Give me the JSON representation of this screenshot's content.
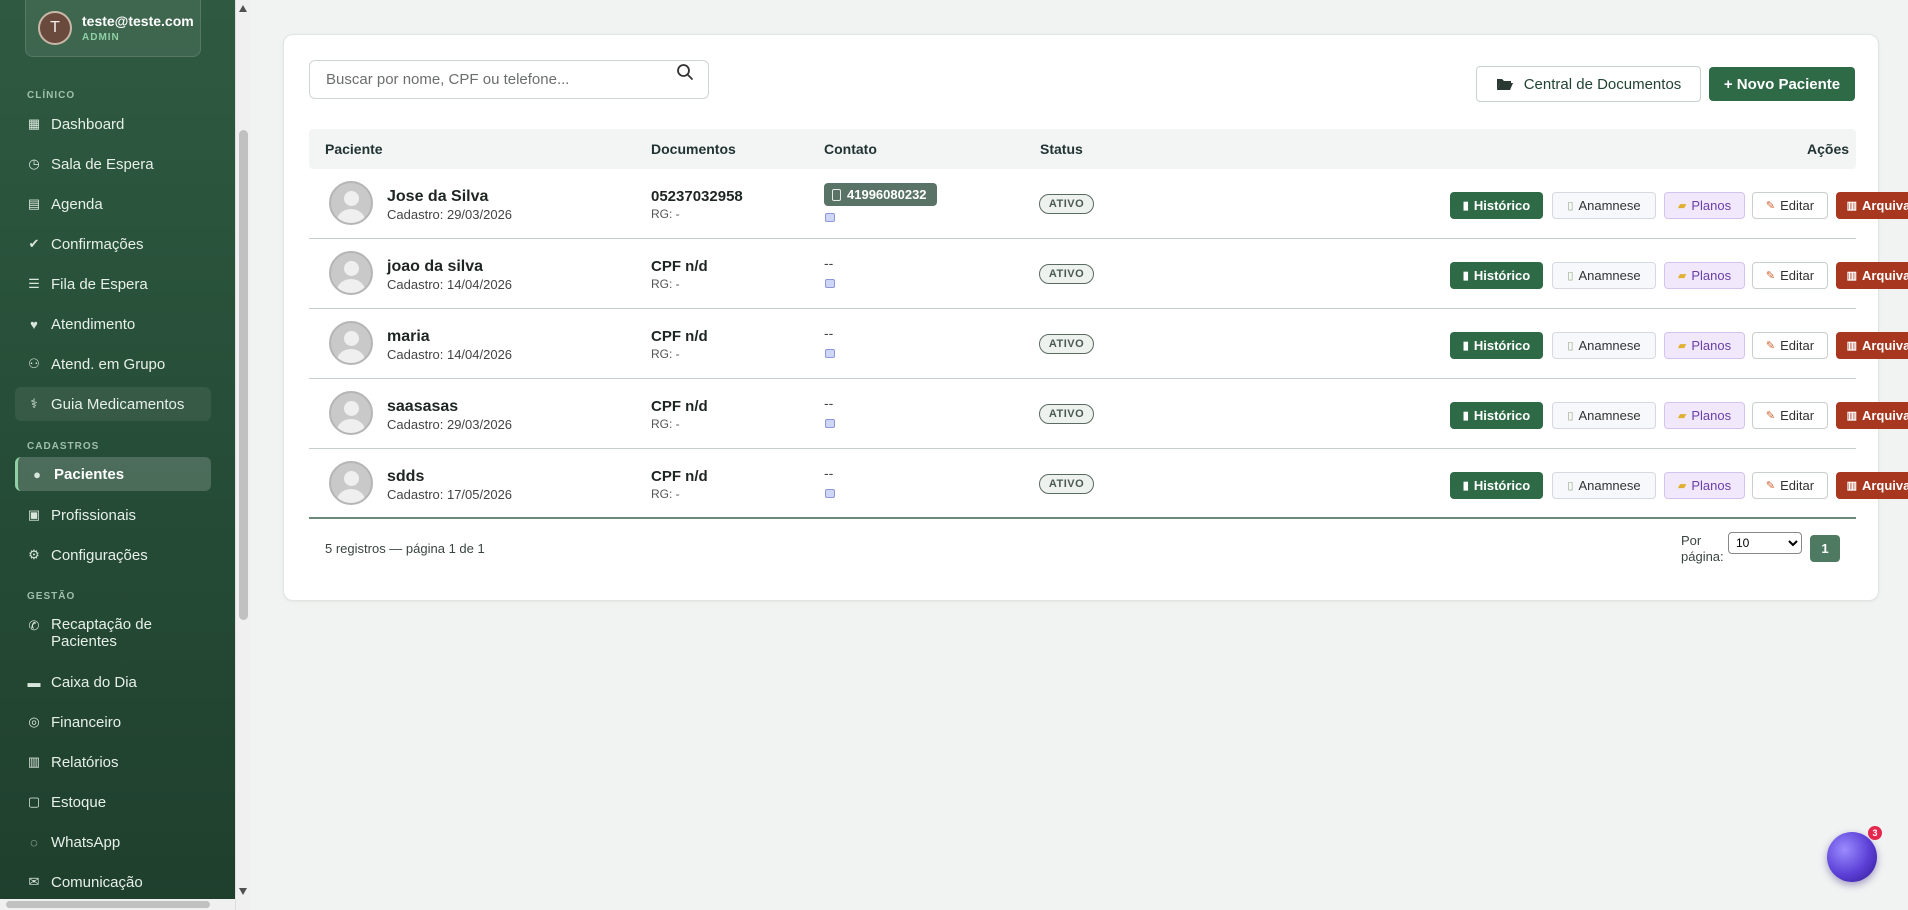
{
  "user": {
    "initial": "T",
    "email": "teste@teste.com",
    "role": "ADMIN"
  },
  "sidebar": {
    "sections": [
      {
        "label": "CLÍNICO",
        "items": [
          {
            "label": "Dashboard",
            "icon": "grid-icon"
          },
          {
            "label": "Sala de Espera",
            "icon": "clock-icon"
          },
          {
            "label": "Agenda",
            "icon": "calendar-icon"
          },
          {
            "label": "Confirmações",
            "icon": "check-circle-icon"
          },
          {
            "label": "Fila de Espera",
            "icon": "list-icon"
          },
          {
            "label": "Atendimento",
            "icon": "heart-pulse-icon"
          },
          {
            "label": "Atend. em Grupo",
            "icon": "users-icon"
          },
          {
            "label": "Guia Medicamentos",
            "icon": "pills-icon"
          }
        ]
      },
      {
        "label": "CADASTROS",
        "items": [
          {
            "label": "Pacientes",
            "icon": "user-icon",
            "active": true
          },
          {
            "label": "Profissionais",
            "icon": "id-badge-icon"
          },
          {
            "label": "Configurações",
            "icon": "gear-icon"
          }
        ]
      },
      {
        "label": "GESTÃO",
        "items": [
          {
            "label": "Recaptação de Pacientes",
            "icon": "megaphone-icon"
          },
          {
            "label": "Caixa do Dia",
            "icon": "briefcase-icon"
          },
          {
            "label": "Financeiro",
            "icon": "coins-icon"
          },
          {
            "label": "Relatórios",
            "icon": "bar-chart-icon"
          },
          {
            "label": "Estoque",
            "icon": "box-icon"
          },
          {
            "label": "WhatsApp",
            "icon": "chat-icon"
          },
          {
            "label": "Comunicação",
            "icon": "envelope-icon"
          }
        ]
      }
    ]
  },
  "toolbar": {
    "search_placeholder": "Buscar por nome, CPF ou telefone...",
    "docs_label": "Central de Documentos",
    "new_label": "+ Novo Paciente"
  },
  "table": {
    "headers": {
      "paciente": "Paciente",
      "documentos": "Documentos",
      "contato": "Contato",
      "status": "Status",
      "acoes": "Ações"
    },
    "rows": [
      {
        "name": "Jose da Silva",
        "date": "Cadastro: 29/03/2026",
        "doc": "05237032958",
        "rg": "RG: -",
        "phone": "41996080232",
        "status": "ATIVO"
      },
      {
        "name": "joao da silva",
        "date": "Cadastro: 14/04/2026",
        "doc": "CPF n/d",
        "rg": "RG: -",
        "contact": "--",
        "status": "ATIVO"
      },
      {
        "name": "maria",
        "date": "Cadastro: 14/04/2026",
        "doc": "CPF n/d",
        "rg": "RG: -",
        "contact": "--",
        "status": "ATIVO"
      },
      {
        "name": "saasasas",
        "date": "Cadastro: 29/03/2026",
        "doc": "CPF n/d",
        "rg": "RG: -",
        "contact": "--",
        "status": "ATIVO"
      },
      {
        "name": "sdds",
        "date": "Cadastro: 17/05/2026",
        "doc": "CPF n/d",
        "rg": "RG: -",
        "contact": "--",
        "status": "ATIVO"
      }
    ],
    "actions": {
      "historico": "Histórico",
      "anamnese": "Anamnese",
      "planos": "Planos",
      "editar": "Editar",
      "arquivar": "Arquivar"
    }
  },
  "pagination": {
    "info": "5 registros — página 1 de 1",
    "per_page_label": "Por página:",
    "per_page_value": "10",
    "current_page": "1"
  },
  "chat_badge": "3",
  "colors": {
    "sidebar": "#2f5a41",
    "primary": "#2f6a47",
    "danger": "#a8371f",
    "planos": "#6a3fa8"
  }
}
